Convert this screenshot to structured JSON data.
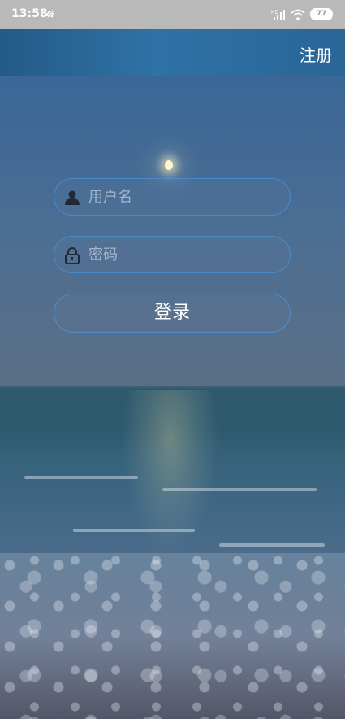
{
  "status_bar": {
    "time": "13:58",
    "battery": "77",
    "icons": [
      "notification-icon",
      "signal-icon",
      "wifi-icon",
      "battery-icon"
    ]
  },
  "header": {
    "register_label": "注册"
  },
  "form": {
    "username": {
      "placeholder": "用户名",
      "value": "",
      "icon": "person-icon"
    },
    "password": {
      "placeholder": "密码",
      "value": "",
      "icon": "lock-icon"
    },
    "login_label": "登录"
  },
  "colors": {
    "title_bar": "#2f72a6",
    "status_bar": "#b9b9b9",
    "field_border": "#4696e1",
    "text": "#ffffff"
  }
}
